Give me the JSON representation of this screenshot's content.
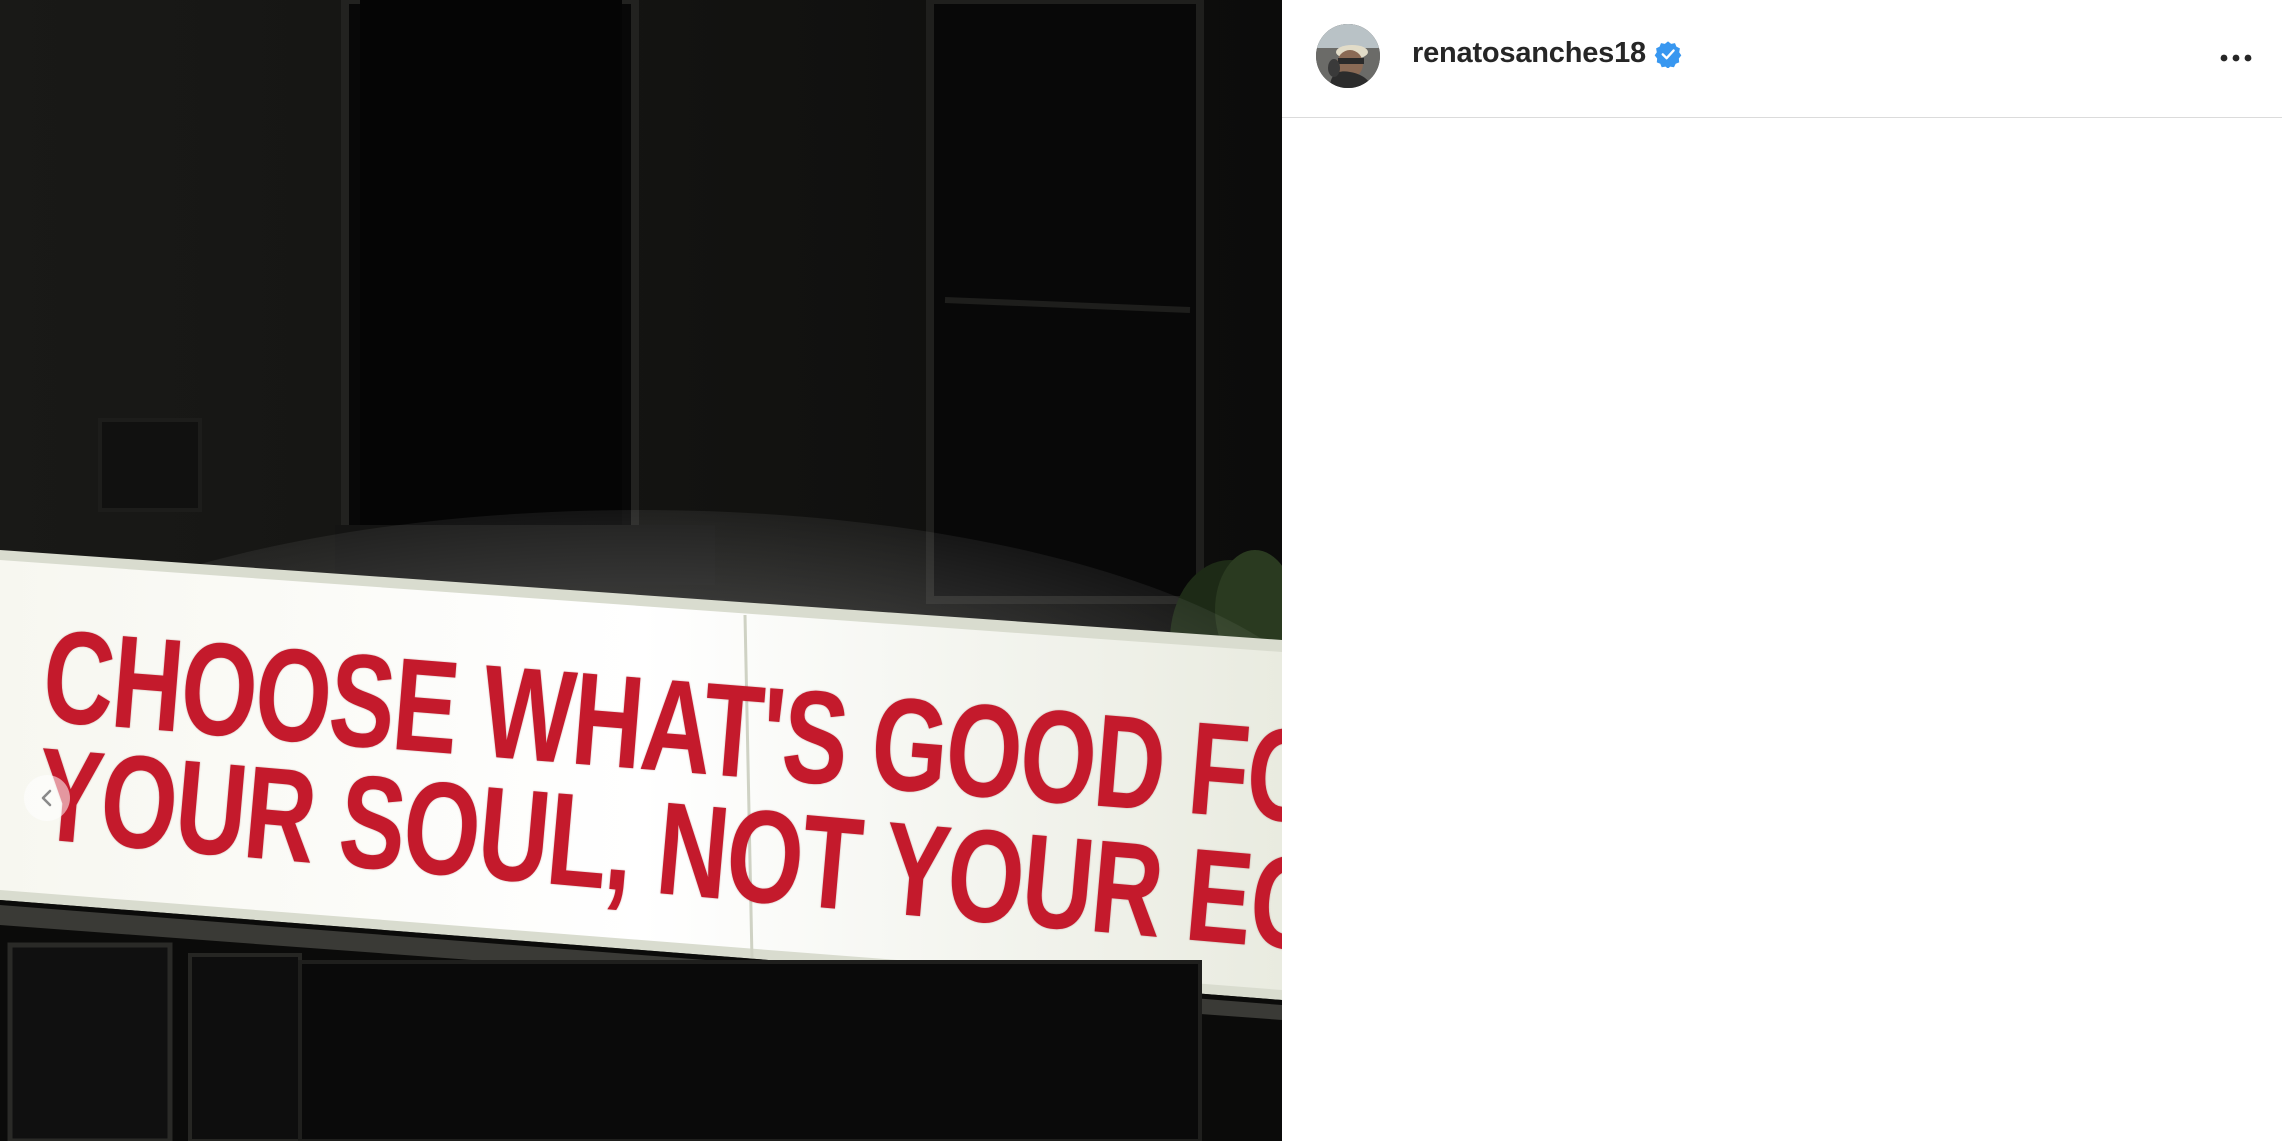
{
  "post": {
    "media": {
      "sign_line_1": "CHOOSE WHAT'S GOOD FOR",
      "sign_line_2": "YOUR SOUL, NOT YOUR EGO",
      "prev_icon": "chevron-left-icon"
    },
    "header": {
      "username": "renatosanches18",
      "verified": true,
      "verified_icon": "verified-badge-icon",
      "more_icon": "more-horizontal-icon",
      "verified_color": "#3897f0"
    }
  },
  "colors": {
    "sign_text": "#c41a2c",
    "divider": "#dbdbdb",
    "username_text": "#262626"
  }
}
